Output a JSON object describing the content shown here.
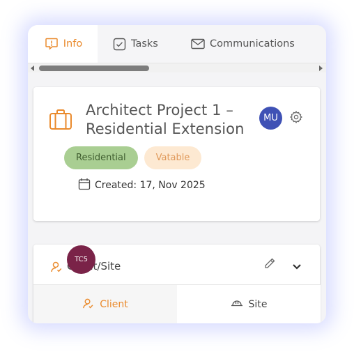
{
  "tabs": [
    {
      "label": "Info",
      "icon": "info-chat-icon",
      "active": true
    },
    {
      "label": "Tasks",
      "icon": "checkbox-icon",
      "active": false
    },
    {
      "label": "Communications",
      "icon": "envelope-icon",
      "active": false
    }
  ],
  "project": {
    "title_line1": "Architect Project 1 –",
    "title_line2": "Residential Extension",
    "avatar_initials": "MU",
    "badges": [
      "Residential",
      "Vatable"
    ],
    "created": "Created: 17, Nov 2025"
  },
  "client_section": {
    "title": "Client/Site",
    "overlay_avatar": "TC5",
    "subtabs": [
      {
        "label": "Client",
        "icon": "client-person-icon",
        "active": true
      },
      {
        "label": "Site",
        "icon": "site-helmet-icon",
        "active": false
      }
    ]
  },
  "colors": {
    "accent": "#ea8a2c",
    "avatar_mu": "#3f51b5",
    "avatar_tc5": "#7a2348",
    "badge_residential_bg": "#a9ce92",
    "badge_vatable_bg": "#fde9d2"
  }
}
